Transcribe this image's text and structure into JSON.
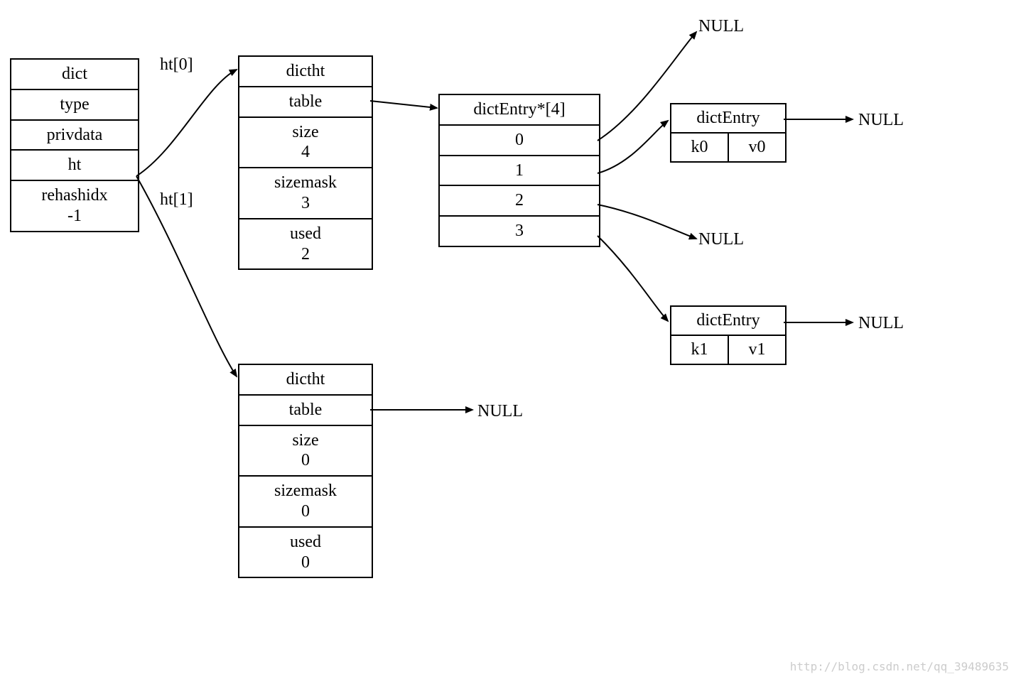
{
  "dict": {
    "title": "dict",
    "type": "type",
    "privdata": "privdata",
    "ht": "ht",
    "rehashidx_label": "rehashidx",
    "rehashidx_val": "-1"
  },
  "edges": {
    "ht0": "ht[0]",
    "ht1": "ht[1]"
  },
  "dictht0": {
    "title": "dictht",
    "table": "table",
    "size_label": "size",
    "size_val": "4",
    "sizemask_label": "sizemask",
    "sizemask_val": "3",
    "used_label": "used",
    "used_val": "2"
  },
  "dictht1": {
    "title": "dictht",
    "table": "table",
    "size_label": "size",
    "size_val": "0",
    "sizemask_label": "sizemask",
    "sizemask_val": "0",
    "used_label": "used",
    "used_val": "0"
  },
  "table_arr": {
    "title": "dictEntry*[4]",
    "idx0": "0",
    "idx1": "1",
    "idx2": "2",
    "idx3": "3"
  },
  "entry0": {
    "title": "dictEntry",
    "k": "k0",
    "v": "v0"
  },
  "entry1": {
    "title": "dictEntry",
    "k": "k1",
    "v": "v1"
  },
  "nulls": {
    "n0": "NULL",
    "n1": "NULL",
    "n2": "NULL",
    "n3": "NULL",
    "n4": "NULL",
    "n5": "NULL"
  },
  "watermark": "http://blog.csdn.net/qq_39489635"
}
